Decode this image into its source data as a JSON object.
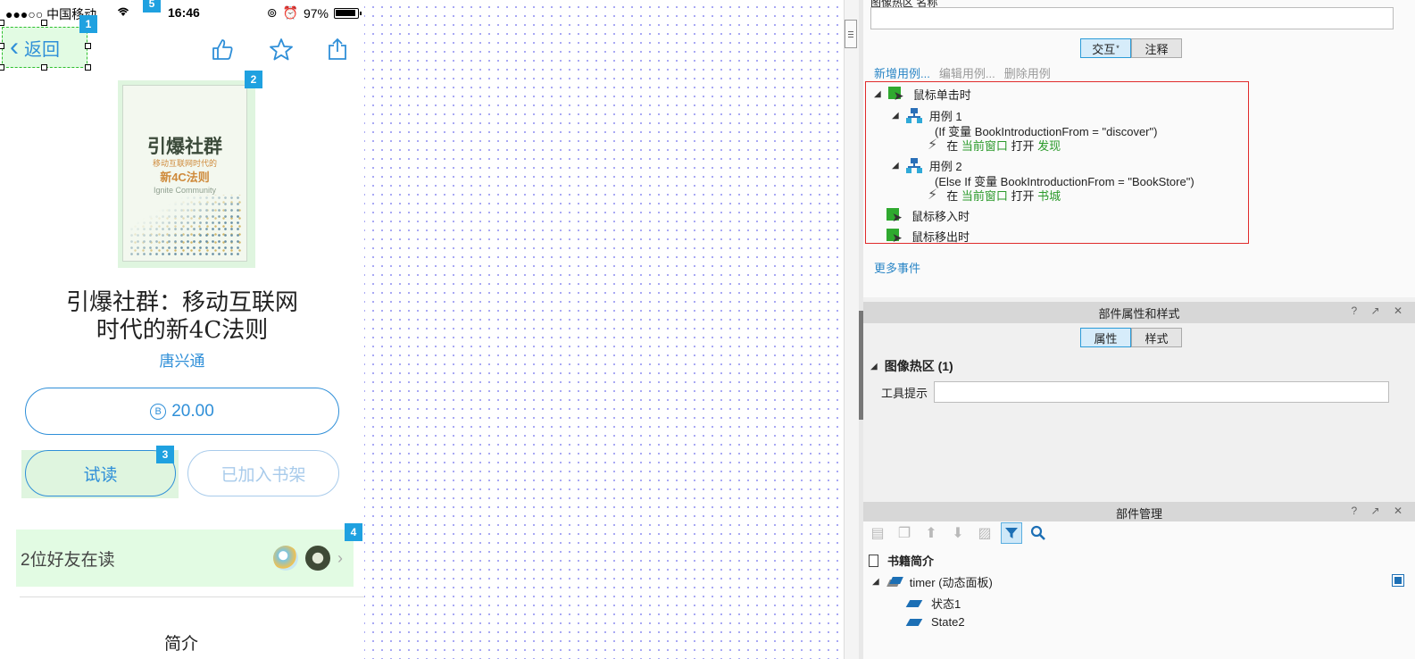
{
  "phone": {
    "status_left": "●●●○○ 中国移动",
    "time": "16:46",
    "battery": "97%",
    "back_label": "返回",
    "badges": [
      "1",
      "2",
      "3",
      "4",
      "5"
    ],
    "book_title_line1": "引爆社群：移动互联网",
    "book_title_line2": "时代的新4C法则",
    "author": "唐兴通",
    "price": "20.00",
    "coin_symbol": "B",
    "try_read": "试读",
    "added_shelf": "已加入书架",
    "friends_reading": "2位好友在读",
    "intro": "简介",
    "cover": {
      "title": "引爆社群",
      "subtitle": "移动互联网时代的",
      "subtitle2": "新4C法则",
      "english": "Ignite Community"
    },
    "nav_icons": [
      "thumbs-up-icon",
      "star-icon",
      "share-icon"
    ]
  },
  "interaction": {
    "name_label": "图像热区 名称",
    "tabs": {
      "interact": "交互",
      "interact_mark": "*",
      "notes": "注释"
    },
    "links": {
      "new_case": "新增用例...",
      "edit_case": "编辑用例...",
      "delete_case": "删除用例"
    },
    "events": {
      "click": "鼠标单击时",
      "case1": "用例 1",
      "case1_cond": "(If 变量 BookIntroductionFrom = \"discover\")",
      "case1_action_pre": "在",
      "case1_action_target": "当前窗口",
      "case1_action_verb": "打开",
      "case1_action_page": "发现",
      "case2": "用例 2",
      "case2_cond": "(Else If 变量 BookIntroductionFrom = \"BookStore\")",
      "case2_action_pre": "在",
      "case2_action_target": "当前窗口",
      "case2_action_verb": "打开",
      "case2_action_page": "书城",
      "mouse_enter": "鼠标移入时",
      "mouse_leave": "鼠标移出时"
    },
    "more_events": "更多事件"
  },
  "properties": {
    "header": "部件属性和样式",
    "tabs": {
      "props": "属性",
      "style": "样式"
    },
    "group": "图像热区 (1)",
    "tooltip_label": "工具提示",
    "header_controls": "? ↗ ✕"
  },
  "widget_manager": {
    "header": "部件管理",
    "header_controls": "? ↗ ✕",
    "page": "书籍简介",
    "panel": "timer (动态面板)",
    "states": [
      "状态1",
      "State2"
    ]
  },
  "colors": {
    "accent_blue": "#2f8fd8",
    "selection_green": "#e2fbe3",
    "event_box_red": "#e02b2b",
    "link_green": "#2b9a2b"
  }
}
